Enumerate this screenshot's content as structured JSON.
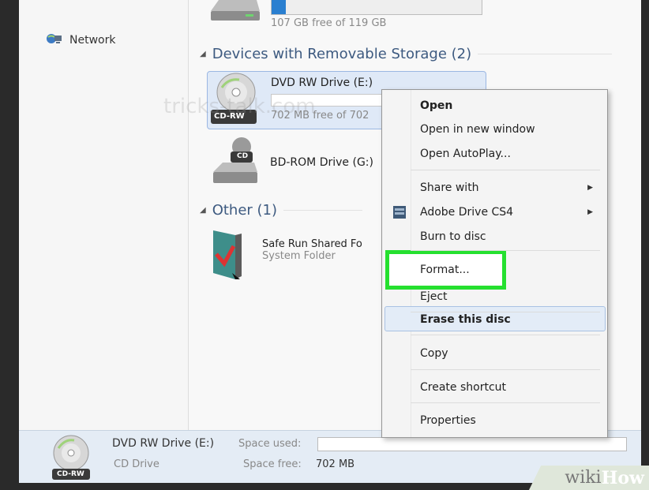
{
  "nav": {
    "network_label": "Network"
  },
  "top_drive": {
    "free_text": "107 GB free of 119 GB"
  },
  "groups": {
    "removable": "Devices with Removable Storage (2)",
    "other": "Other (1)"
  },
  "drives": [
    {
      "name": "DVD RW Drive (E:)",
      "free_text": "702 MB free of 702",
      "badge": "CD-RW",
      "capacity_used_fraction": 0
    },
    {
      "name": "BD-ROM Drive (G:)",
      "badge": "CD"
    }
  ],
  "other_items": [
    {
      "name": "Safe Run Shared Fo",
      "type": "System Folder"
    }
  ],
  "context_menu": {
    "items": [
      {
        "label": "Open",
        "bold": true,
        "arrow": false
      },
      {
        "label": "Open in new window",
        "arrow": false
      },
      {
        "label": "Open AutoPlay...",
        "arrow": false
      },
      {
        "label": "Share with",
        "arrow": true
      },
      {
        "label": "Adobe Drive CS4",
        "arrow": true,
        "icon": "adobe-drive-icon"
      },
      {
        "label": "Burn to disc",
        "arrow": false
      },
      {
        "label": "Format...",
        "arrow": false,
        "highlighted": true
      },
      {
        "label": "Eject",
        "arrow": false
      },
      {
        "label": "Erase this disc",
        "arrow": false,
        "hovered": true
      },
      {
        "label": "Copy",
        "arrow": false
      },
      {
        "label": "Create shortcut",
        "arrow": false
      },
      {
        "label": "Properties",
        "arrow": false
      }
    ]
  },
  "details": {
    "name": "DVD RW Drive (E:)",
    "type": "CD Drive",
    "badge": "CD-RW",
    "space_used_label": "Space used:",
    "space_free_label": "Space free:",
    "space_free_value": "702 MB"
  },
  "watermark": "tricks-talk.com",
  "branding": {
    "wiki": "wiki",
    "how": "How"
  },
  "colors": {
    "highlight_green": "#25e02f",
    "selection_blue": "#dfe9f7"
  }
}
